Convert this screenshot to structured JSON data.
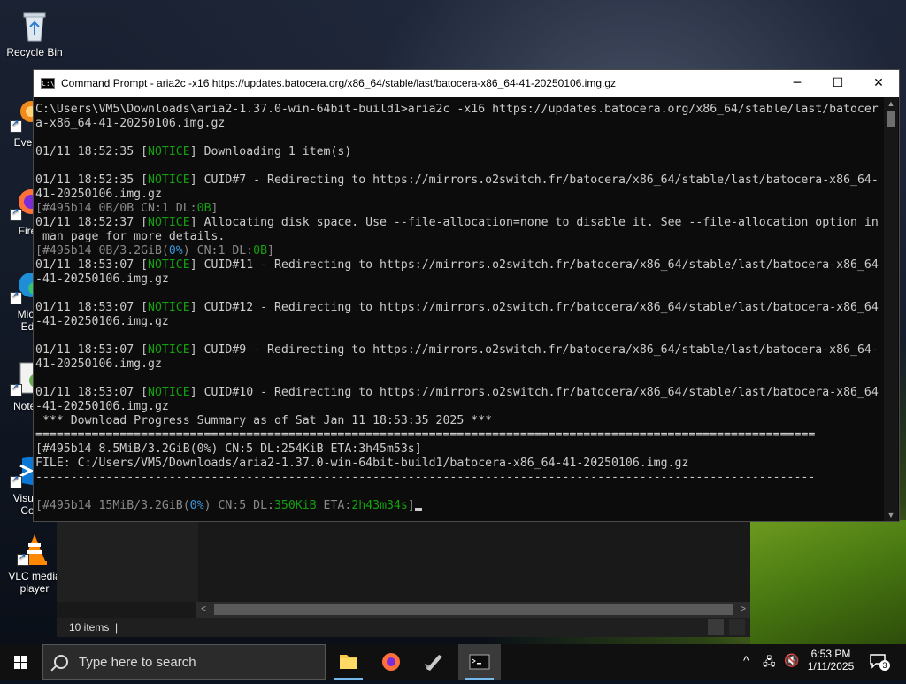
{
  "desktop": {
    "icons": [
      {
        "label": "Recycle Bin"
      },
      {
        "label": "Every"
      },
      {
        "label": "Fire"
      },
      {
        "label": "Micr"
      },
      {
        "label": "Ed"
      },
      {
        "label": "Notep"
      },
      {
        "label": "Visual"
      },
      {
        "label": "Co"
      },
      {
        "label": "VLC media"
      },
      {
        "label": "player"
      }
    ]
  },
  "explorer": {
    "status": "10 items",
    "cursor_glyph": "|"
  },
  "cmd": {
    "title": "Command Prompt - aria2c  -x16 https://updates.batocera.org/x86_64/stable/last/batocera-x86_64-41-20250106.img.gz",
    "minimize_glyph": "─",
    "maximize_glyph": "☐",
    "close_glyph": "✕",
    "lines": {
      "l01": "C:\\Users\\VM5\\Downloads\\aria2-1.37.0-win-64bit-build1>aria2c -x16 https://updates.batocera.org/x86_64/stable/last/batocer",
      "l02": "a-x86_64-41-20250106.img.gz",
      "l04a": "01/11 18:52:35 [",
      "notice": "NOTICE",
      "l04b": "] Downloading 1 item(s)",
      "l06a": "01/11 18:52:35 [",
      "l06b": "] CUID#7 - Redirecting to https://mirrors.o2switch.fr/batocera/x86_64/stable/last/batocera-x86_64-",
      "l07": "41-20250106.img.gz",
      "l08a": "[#495b14 0B/0B CN:1 DL:",
      "l08b": "0B",
      "l08c": "]",
      "l09a": "01/11 18:52:37 [",
      "l09b": "] Allocating disk space. Use --file-allocation=none to disable it. See --file-allocation option in",
      "l10": " man page for more details.",
      "l11a": "[#495b14 0B/3.2GiB(",
      "l11b": "0%",
      "l11c": ") CN:1 DL:",
      "l11d": "0B",
      "l11e": "]",
      "l12a": "01/11 18:53:07 [",
      "l12b": "] CUID#11 - Redirecting to https://mirrors.o2switch.fr/batocera/x86_64/stable/last/batocera-x86_64",
      "l13": "-41-20250106.img.gz",
      "l15a": "01/11 18:53:07 [",
      "l15b": "] CUID#12 - Redirecting to https://mirrors.o2switch.fr/batocera/x86_64/stable/last/batocera-x86_64",
      "l16": "-41-20250106.img.gz",
      "l18a": "01/11 18:53:07 [",
      "l18b": "] CUID#9 - Redirecting to https://mirrors.o2switch.fr/batocera/x86_64/stable/last/batocera-x86_64-",
      "l19": "41-20250106.img.gz",
      "l21a": "01/11 18:53:07 [",
      "l21b": "] CUID#10 - Redirecting to https://mirrors.o2switch.fr/batocera/x86_64/stable/last/batocera-x86_64",
      "l22": "-41-20250106.img.gz",
      "l23": " *** Download Progress Summary as of Sat Jan 11 18:53:35 2025 ***",
      "l24": "===============================================================================================================",
      "l25": "[#495b14 8.5MiB/3.2GiB(0%) CN:5 DL:254KiB ETA:3h45m53s]",
      "l26": "FILE: C:/Users/VM5/Downloads/aria2-1.37.0-win-64bit-build1/batocera-x86_64-41-20250106.img.gz",
      "l27": "---------------------------------------------------------------------------------------------------------------",
      "l29a": "[#495b14 15MiB/3.2GiB(",
      "l29b": "0%",
      "l29c": ") CN:5 DL:",
      "l29d": "350KiB",
      "l29e": " ETA:",
      "l29f": "2h43m34s",
      "l29g": "]"
    }
  },
  "taskbar": {
    "search_placeholder": "Type here to search",
    "time": "6:53 PM",
    "date": "1/11/2025",
    "notification_count": "3"
  },
  "colors": {
    "notice": "#13a10e",
    "dl_rate": "#13a10e",
    "percent": "#3a96dd",
    "accent": "#76b9ed"
  }
}
